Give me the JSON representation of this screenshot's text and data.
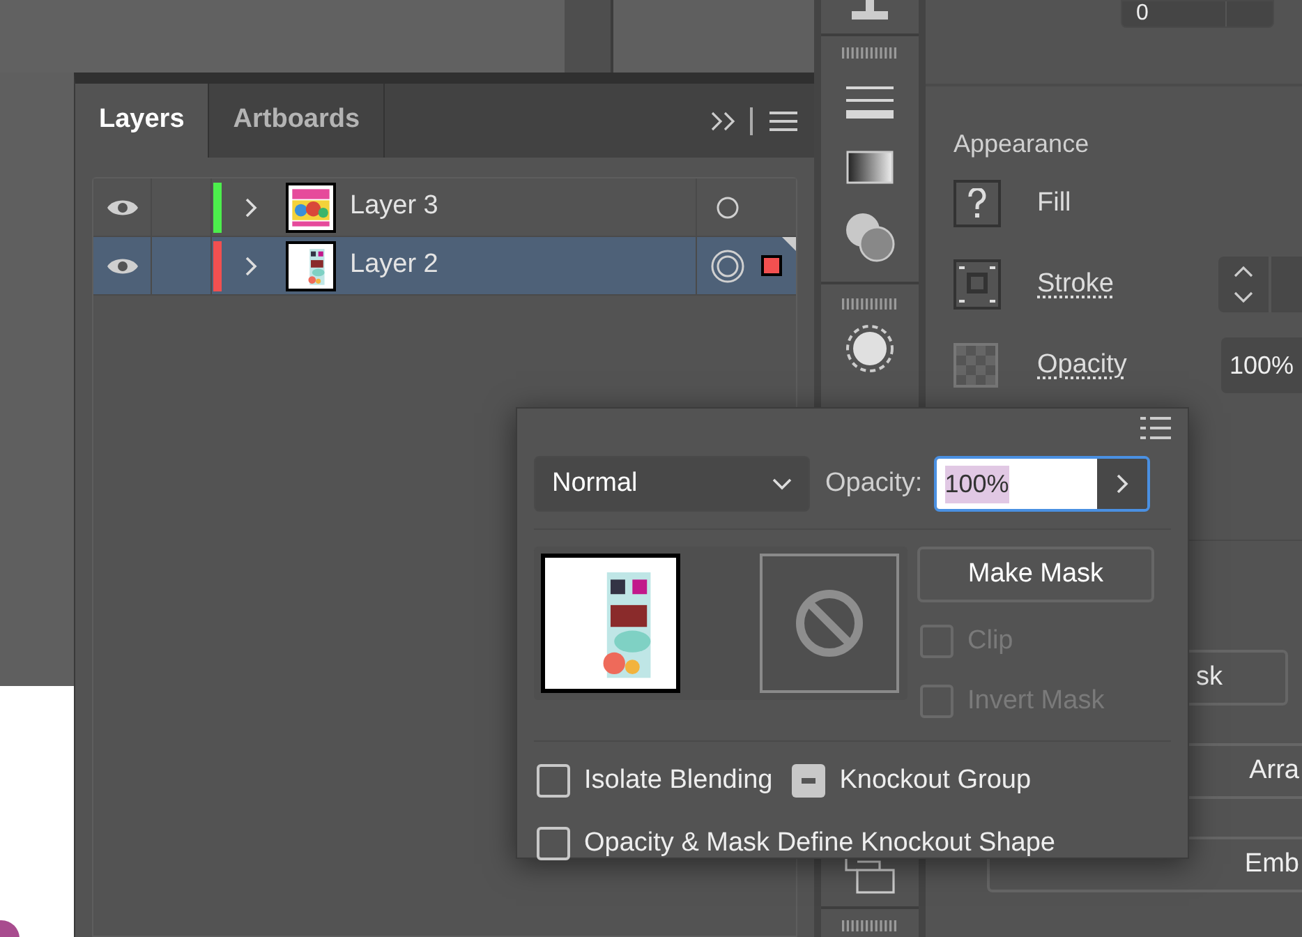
{
  "layers_panel": {
    "tabs": [
      {
        "label": "Layers",
        "selected": true
      },
      {
        "label": "Artboards",
        "selected": false
      }
    ],
    "layers": [
      {
        "name": "Layer 3",
        "visible": true,
        "color": "#4cee4c",
        "selected": false,
        "targeted": false
      },
      {
        "name": "Layer 2",
        "visible": true,
        "color": "#f25050",
        "selected": true,
        "targeted": true
      }
    ]
  },
  "properties": {
    "top_field": "0",
    "appearance": {
      "title": "Appearance",
      "rows": [
        {
          "kind": "fill",
          "label": "Fill"
        },
        {
          "kind": "stroke",
          "label": "Stroke"
        },
        {
          "kind": "opacity",
          "label": "Opacity",
          "value": "100%"
        }
      ]
    },
    "buttons": [
      "sk",
      "Arra",
      "Emb"
    ]
  },
  "transparency_popup": {
    "blend_mode": "Normal",
    "opacity_label": "Opacity:",
    "opacity_value": "100%",
    "make_mask": "Make Mask",
    "mask_options": [
      {
        "label": "Clip",
        "checked": false,
        "disabled": true
      },
      {
        "label": "Invert Mask",
        "checked": false,
        "disabled": true
      }
    ],
    "options": [
      {
        "label": "Isolate Blending",
        "indeterminate": false
      },
      {
        "label": "Knockout Group",
        "indeterminate": true
      },
      {
        "label": "Opacity & Mask Define Knockout Shape",
        "indeterminate": false
      }
    ]
  }
}
